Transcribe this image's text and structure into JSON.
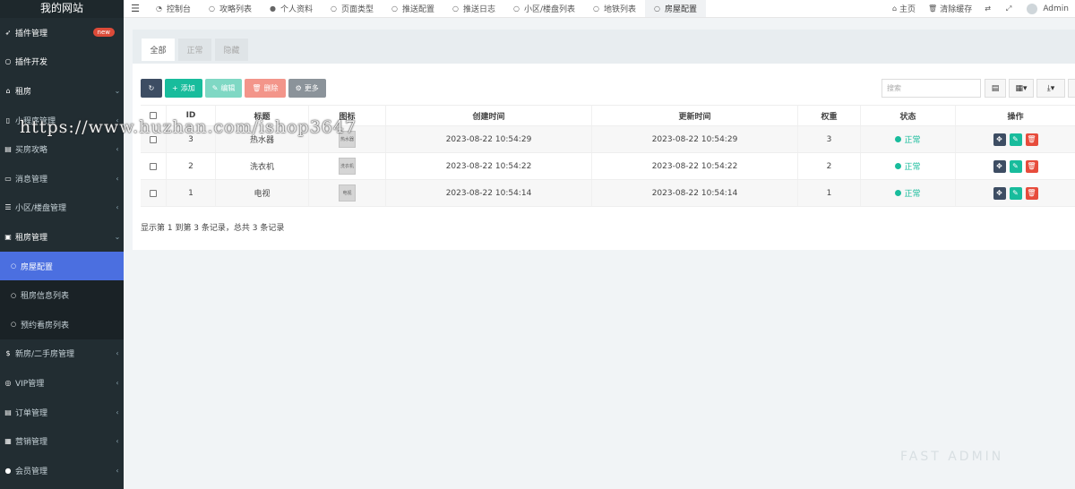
{
  "app": {
    "site_name": "我的网站"
  },
  "sidebar": {
    "items": [
      {
        "label": "插件管理",
        "icon": "rocket-icon",
        "icon_glyph": "➶",
        "badge": "new",
        "type": "head"
      },
      {
        "label": "插件开发",
        "icon": "circle-icon",
        "icon_glyph": "○",
        "type": "head"
      },
      {
        "label": "租房",
        "icon": "home-icon",
        "icon_glyph": "⌂",
        "arrow": "⌄",
        "type": "head"
      },
      {
        "label": "小程序管理",
        "icon": "mobile-icon",
        "icon_glyph": "▯",
        "arrow": "‹",
        "type": "item"
      },
      {
        "label": "买房攻略",
        "icon": "book-icon",
        "icon_glyph": "▤",
        "arrow": "‹",
        "type": "item"
      },
      {
        "label": "消息管理",
        "icon": "message-icon",
        "icon_glyph": "▭",
        "arrow": "‹",
        "type": "item"
      },
      {
        "label": "小区/楼盘管理",
        "icon": "list-icon",
        "icon_glyph": "☰",
        "arrow": "‹",
        "type": "item"
      },
      {
        "label": "租房管理",
        "icon": "square-h-icon",
        "icon_glyph": "▣",
        "arrow": "⌄",
        "type": "head"
      },
      {
        "label": "房屋配置",
        "icon": "circle-icon",
        "icon_glyph": "○",
        "type": "sub-active"
      },
      {
        "label": "租房信息列表",
        "icon": "circle-icon",
        "icon_glyph": "○",
        "type": "sub"
      },
      {
        "label": "预约看房列表",
        "icon": "circle-icon",
        "icon_glyph": "○",
        "type": "sub"
      },
      {
        "label": "新房/二手房管理",
        "icon": "money-icon",
        "icon_glyph": "$",
        "arrow": "‹",
        "type": "item"
      },
      {
        "label": "VIP管理",
        "icon": "vip-icon",
        "icon_glyph": "◎",
        "arrow": "‹",
        "type": "item"
      },
      {
        "label": "订单管理",
        "icon": "order-icon",
        "icon_glyph": "▤",
        "arrow": "‹",
        "type": "item"
      },
      {
        "label": "营销管理",
        "icon": "marketing-icon",
        "icon_glyph": "▦",
        "arrow": "‹",
        "type": "item"
      },
      {
        "label": "会员管理",
        "icon": "user-icon",
        "icon_glyph": "●",
        "arrow": "‹",
        "type": "item"
      }
    ]
  },
  "topnav": {
    "menu_icon": "menu-icon",
    "tabs": [
      {
        "label": "控制台",
        "icon": "dashboard-icon",
        "glyph": "◔"
      },
      {
        "label": "攻略列表",
        "icon": "circle-icon",
        "glyph": "○"
      },
      {
        "label": "个人资料",
        "icon": "user-icon",
        "glyph": "●"
      },
      {
        "label": "页面类型",
        "icon": "circle-icon",
        "glyph": "○"
      },
      {
        "label": "推送配置",
        "icon": "circle-icon",
        "glyph": "○"
      },
      {
        "label": "推送日志",
        "icon": "circle-icon",
        "glyph": "○"
      },
      {
        "label": "小区/楼盘列表",
        "icon": "circle-icon",
        "glyph": "○"
      },
      {
        "label": "地铁列表",
        "icon": "circle-icon",
        "glyph": "○"
      },
      {
        "label": "房屋配置",
        "icon": "circle-icon",
        "glyph": "○",
        "active": true
      }
    ],
    "right": {
      "home": "主页",
      "clear_cache": "清除缓存",
      "user": "Admin"
    }
  },
  "filter_tabs": [
    "全部",
    "正常",
    "隐藏"
  ],
  "toolbar": {
    "add": "添加",
    "edit": "编辑",
    "delete": "删除",
    "more": "更多",
    "search_placeholder": "搜索"
  },
  "table": {
    "headers": [
      "ID",
      "标题",
      "图标",
      "创建时间",
      "更新时间",
      "权重",
      "状态",
      "操作"
    ],
    "rows": [
      {
        "id": "3",
        "title": "热水器",
        "icon_text": "热水器",
        "created": "2023-08-22 10:54:29",
        "updated": "2023-08-22 10:54:29",
        "weight": "3",
        "status": "正常"
      },
      {
        "id": "2",
        "title": "洗衣机",
        "icon_text": "洗衣机",
        "created": "2023-08-22 10:54:22",
        "updated": "2023-08-22 10:54:22",
        "weight": "2",
        "status": "正常"
      },
      {
        "id": "1",
        "title": "电视",
        "icon_text": "电视",
        "created": "2023-08-22 10:54:14",
        "updated": "2023-08-22 10:54:14",
        "weight": "1",
        "status": "正常"
      }
    ]
  },
  "pagination": {
    "info": "显示第 1 到第 3 条记录，总共 3 条记录"
  },
  "watermarks": {
    "url": "https://www.huzhan.com/ishop3647",
    "brand": "FAST ADMIN"
  },
  "colors": {
    "sidebar_bg": "#222d32",
    "active_blue": "#4b6fe0",
    "success": "#18bc9c",
    "danger": "#e74c3c",
    "dark": "#3d4d63"
  }
}
